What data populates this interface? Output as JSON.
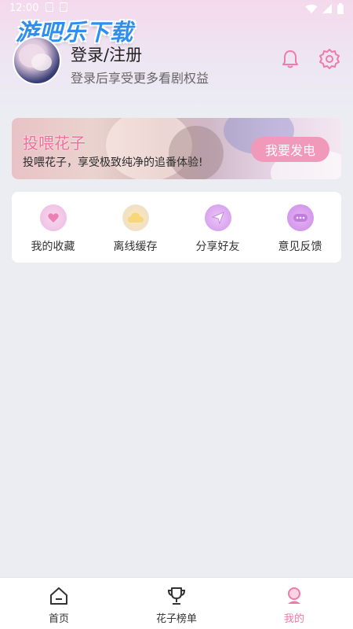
{
  "status_bar": {
    "time": "12:00",
    "icons": [
      "wifi-icon",
      "signal-icon",
      "battery-icon"
    ]
  },
  "watermark": "游吧乐下载",
  "profile": {
    "title": "登录/注册",
    "subtitle": "登录后享受更多看剧权益",
    "icons": [
      "bell-icon",
      "gear-icon"
    ]
  },
  "banner": {
    "title": "投喂花子",
    "subtitle": "投喂花子，享受极致纯净的追番体验!",
    "button": "我要发电"
  },
  "menu": [
    {
      "label": "我的收藏",
      "icon": "favorite-icon"
    },
    {
      "label": "离线缓存",
      "icon": "cloud-download-icon"
    },
    {
      "label": "分享好友",
      "icon": "share-icon"
    },
    {
      "label": "意见反馈",
      "icon": "feedback-icon"
    }
  ],
  "bottom_nav": [
    {
      "label": "首页",
      "icon": "home-icon",
      "active": false
    },
    {
      "label": "花子榜单",
      "icon": "trophy-icon",
      "active": false
    },
    {
      "label": "我的",
      "icon": "profile-icon",
      "active": true
    }
  ],
  "colors": {
    "accent": "#f07aa8",
    "banner_button": "#f199b9",
    "background": "#ecedf3"
  }
}
